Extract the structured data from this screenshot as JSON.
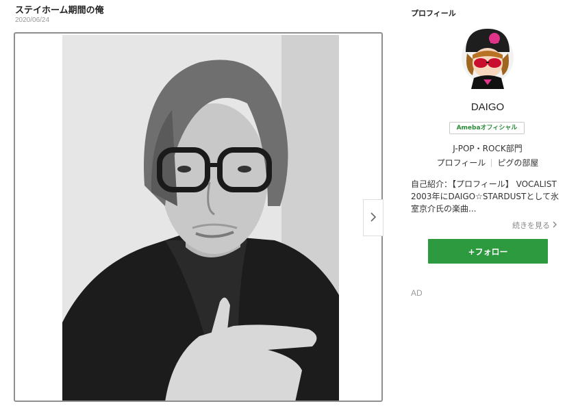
{
  "post": {
    "title": "ステイホーム期間の俺",
    "date": "2020/06/24"
  },
  "gallery": {
    "next_icon": "chevron-right-icon"
  },
  "sidebar": {
    "heading": "プロフィール",
    "blog_name": "DAIGO",
    "badge": "Amebaオフィシャル",
    "genre": "J-POP・ROCK部門",
    "links": [
      "プロフィール",
      "ピグの部屋"
    ],
    "intro": "自己紹介：【プロフィール】 VOCALIST 2003年にDAIGO☆STARDUSTとして氷室京介氏の楽曲...",
    "read_more": "続きを見る",
    "follow_label": "+フォロー",
    "ad_label": "AD"
  },
  "colors": {
    "accent_green": "#2e9a3f",
    "badge_green": "#2d8c3c"
  }
}
